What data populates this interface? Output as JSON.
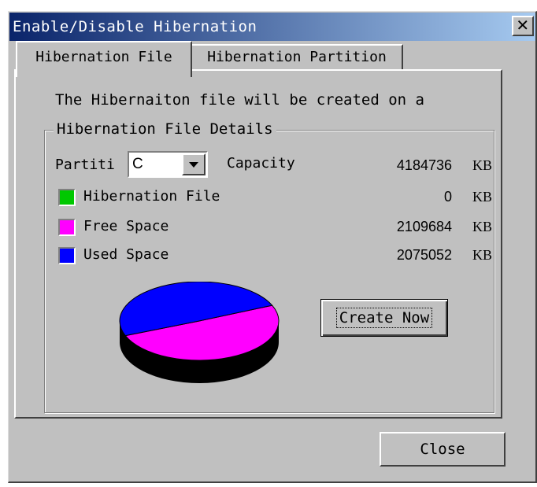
{
  "window": {
    "title": "Enable/Disable Hibernation"
  },
  "tabs": [
    {
      "label": "Hibernation File",
      "active": true
    },
    {
      "label": "Hibernation Partition",
      "active": false
    }
  ],
  "info_text": "The Hibernaiton file will be created on a",
  "details": {
    "group_title": "Hibernation File Details",
    "partition_label": "Partiti",
    "partition_value": "C",
    "capacity_label": "Capacity",
    "capacity_value": "4184736",
    "unit": "KB",
    "rows": [
      {
        "label": "Hibernation File",
        "value": "0",
        "unit": "KB",
        "color": "#00c800"
      },
      {
        "label": "Free Space",
        "value": "2109684",
        "unit": "KB",
        "color": "#ff00ff"
      },
      {
        "label": "Used Space",
        "value": "2075052",
        "unit": "KB",
        "color": "#0000ff"
      }
    ]
  },
  "chart_data": {
    "type": "pie",
    "slices": [
      {
        "name": "Hibernation File",
        "value": 0,
        "color": "#00c800"
      },
      {
        "name": "Free Space",
        "value": 2109684,
        "color": "#ff00ff"
      },
      {
        "name": "Used Space",
        "value": 2075052,
        "color": "#0000ff"
      }
    ]
  },
  "buttons": {
    "create_now": "Create Now",
    "close": "Close"
  },
  "icons": {
    "close": "close-icon",
    "dropdown": "chevron-down-icon"
  }
}
